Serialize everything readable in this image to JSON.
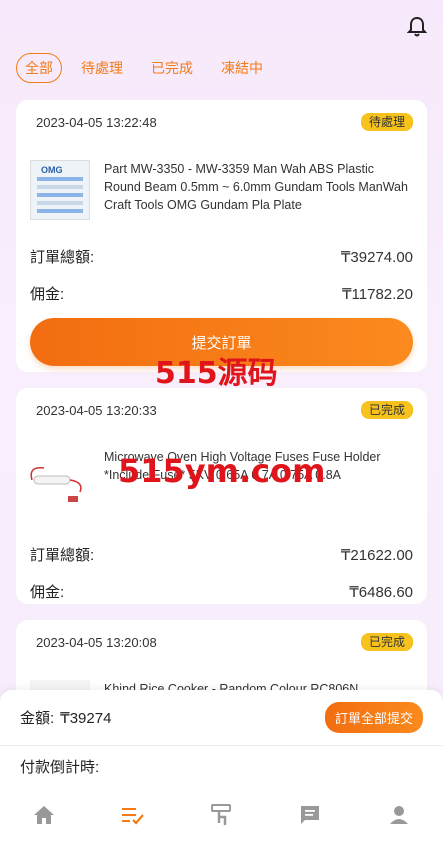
{
  "tabs": [
    {
      "label": "全部",
      "active": true
    },
    {
      "label": "待處理",
      "active": false
    },
    {
      "label": "已完成",
      "active": false
    },
    {
      "label": "凍結中",
      "active": false
    }
  ],
  "orders": [
    {
      "timestamp": "2023-04-05 13:22:48",
      "status": "待處理",
      "product": "Part MW-3350 - MW-3359 Man Wah ABS Plastic Round Beam 0.5mm ~ 6.0mm Gundam Tools ManWah Craft Tools OMG Gundam Pla Plate",
      "thumb_text": "OMG",
      "total_label": "訂單總額:",
      "total": "₸39274.00",
      "commission_label": "佣金:",
      "commission": "₸11782.20",
      "submit_label": "提交訂單"
    },
    {
      "timestamp": "2023-04-05 13:20:33",
      "status": "已完成",
      "product": "Microwave Oven High Voltage Fuses Fuse Holder *Include Fuse* 5KV 0.65A 0.7A 0.75A 0.8A",
      "total_label": "訂單總額:",
      "total": "₸21622.00",
      "commission_label": "佣金:",
      "commission": "₸6486.60"
    },
    {
      "timestamp": "2023-04-05 13:20:08",
      "status": "已完成",
      "product": "Khind Rice Cooker - Random Colour RC806N"
    }
  ],
  "watermarks": [
    "515源码",
    "515ym.com"
  ],
  "summary": {
    "amount_label": "金額:",
    "amount": "₸39274",
    "submit_all_label": "訂單全部提交",
    "countdown_label": "付款倒計時:"
  },
  "nav": [
    "home-icon",
    "orders-icon",
    "deposit-icon",
    "message-icon",
    "profile-icon"
  ],
  "colors": {
    "accent": "#f47b16",
    "badge": "#f6c21b",
    "watermark": "#e0141b"
  }
}
